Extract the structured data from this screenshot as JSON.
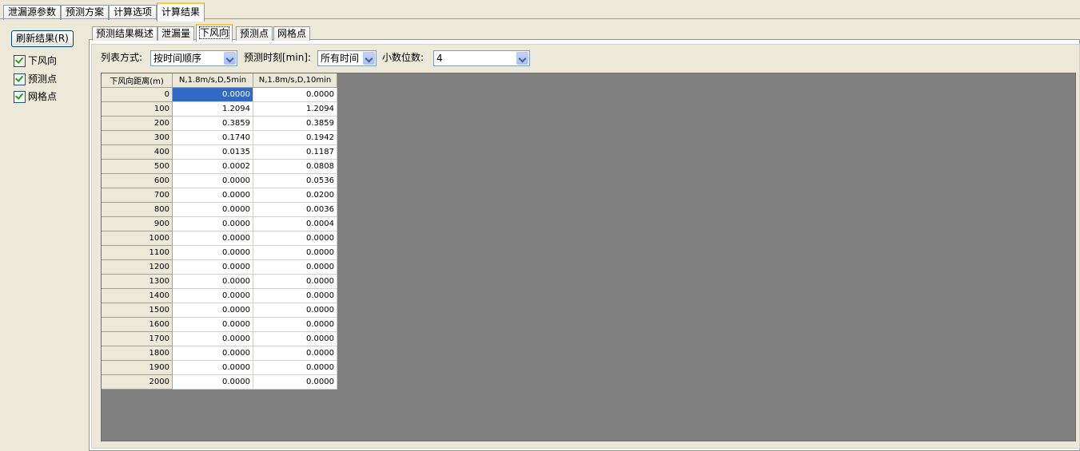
{
  "top_tabs": [
    "泄漏源参数",
    "预测方案",
    "计算选项",
    "计算结果"
  ],
  "left_panel": {
    "refresh_label": "刷新结果(R)",
    "checkboxes": [
      {
        "label": "下风向",
        "checked": true
      },
      {
        "label": "预测点",
        "checked": true
      },
      {
        "label": "网格点",
        "checked": true
      }
    ]
  },
  "inner_tabs": [
    "预测结果概述",
    "泄漏量",
    "下风向",
    "预测点",
    "网格点"
  ],
  "toolbar": {
    "list_mode_label": "列表方式:",
    "list_mode_value": "按时间顺序",
    "time_label": "预测时刻[min]:",
    "time_value": "所有时间",
    "decimals_label": "小数位数:",
    "decimals_value": "4"
  },
  "grid": {
    "headers": [
      "下风向距离(m)",
      "N,1.8m/s,D,5min",
      "N,1.8m/s,D,10min"
    ],
    "rows": [
      [
        "0",
        "0.0000",
        "0.0000"
      ],
      [
        "100",
        "1.2094",
        "1.2094"
      ],
      [
        "200",
        "0.3859",
        "0.3859"
      ],
      [
        "300",
        "0.1740",
        "0.1942"
      ],
      [
        "400",
        "0.0135",
        "0.1187"
      ],
      [
        "500",
        "0.0002",
        "0.0808"
      ],
      [
        "600",
        "0.0000",
        "0.0536"
      ],
      [
        "700",
        "0.0000",
        "0.0200"
      ],
      [
        "800",
        "0.0000",
        "0.0036"
      ],
      [
        "900",
        "0.0000",
        "0.0004"
      ],
      [
        "1000",
        "0.0000",
        "0.0000"
      ],
      [
        "1100",
        "0.0000",
        "0.0000"
      ],
      [
        "1200",
        "0.0000",
        "0.0000"
      ],
      [
        "1300",
        "0.0000",
        "0.0000"
      ],
      [
        "1400",
        "0.0000",
        "0.0000"
      ],
      [
        "1500",
        "0.0000",
        "0.0000"
      ],
      [
        "1600",
        "0.0000",
        "0.0000"
      ],
      [
        "1700",
        "0.0000",
        "0.0000"
      ],
      [
        "1800",
        "0.0000",
        "0.0000"
      ],
      [
        "1900",
        "0.0000",
        "0.0000"
      ],
      [
        "2000",
        "0.0000",
        "0.0000"
      ]
    ]
  }
}
